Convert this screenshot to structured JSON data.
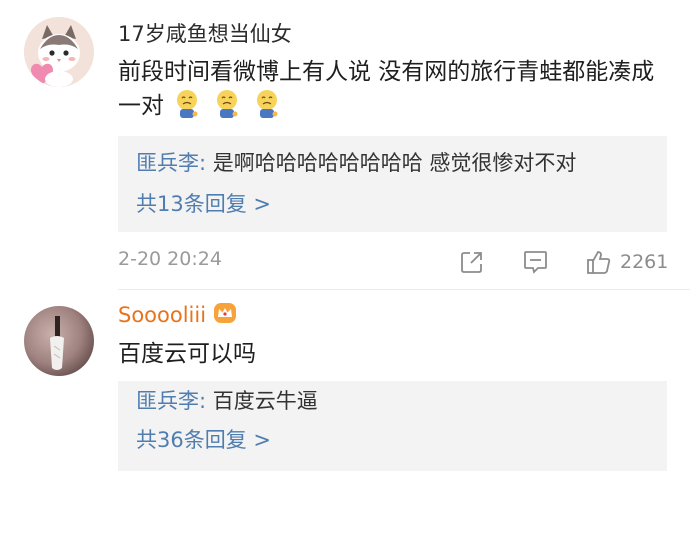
{
  "comments": [
    {
      "username": "17岁咸鱼想当仙女",
      "text": "前段时间看微博上有人说 没有网的旅行青蛙都能凑成一对",
      "emoji": [
        "cry-emoji",
        "cry-emoji",
        "cry-emoji"
      ],
      "reply": {
        "user": "匪兵李",
        "separator": ":",
        "text": " 是啊哈哈哈哈哈哈哈哈 感觉很惨对不对"
      },
      "more": "共13条回复 >",
      "time": "2-20 20:24",
      "likes": "2261"
    },
    {
      "username": "Sooooliii",
      "text": "百度云可以吗",
      "reply": {
        "user": "匪兵李",
        "separator": ":",
        "text": " 百度云牛逼"
      },
      "more": "共36条回复 >"
    }
  ],
  "colors": {
    "link": "#507daf",
    "vip_name": "#e8731c",
    "muted": "#9a9a9a",
    "reply_bg": "#f3f3f3"
  }
}
